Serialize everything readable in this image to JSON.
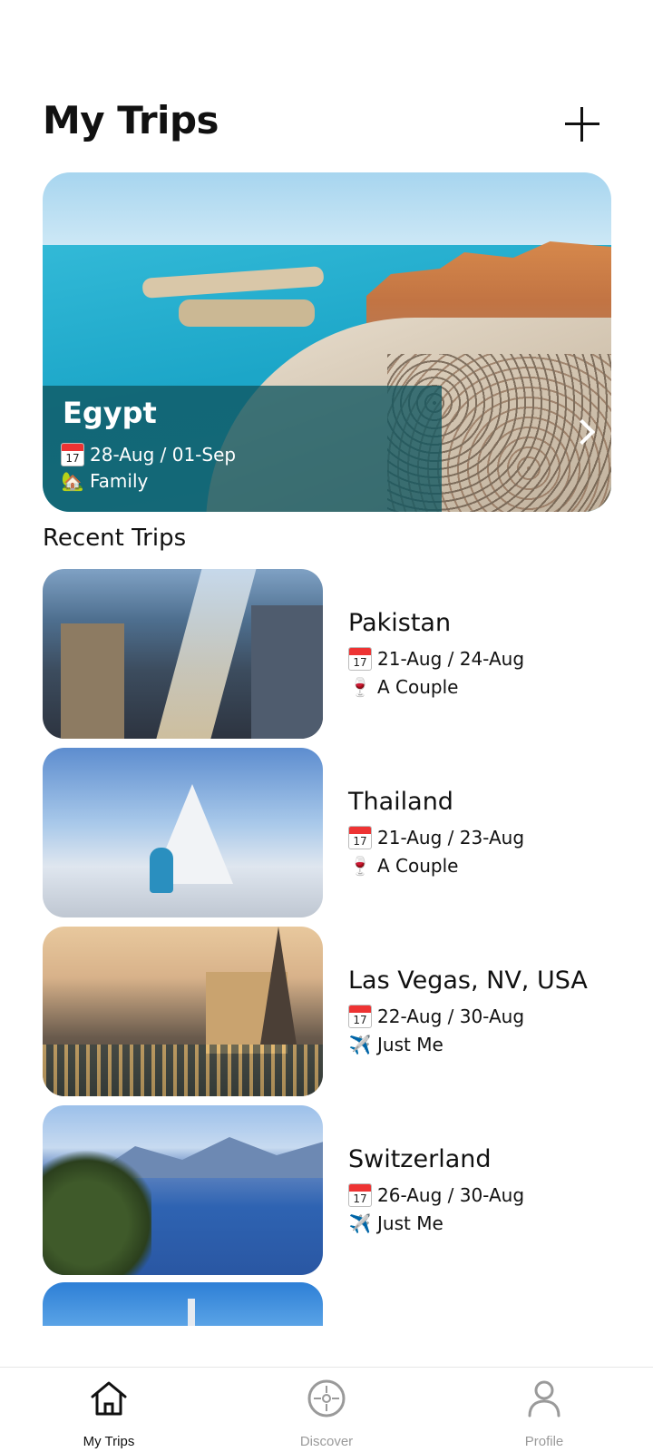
{
  "header": {
    "title": "My Trips",
    "add_icon": "plus-icon"
  },
  "featured_trip": {
    "name": "Egypt",
    "dates": "28-Aug / 01-Sep",
    "group": "Family",
    "date_icon": "calendar-icon",
    "group_icon": "house-icon",
    "chevron_icon": "chevron-right-icon"
  },
  "recent": {
    "title": "Recent Trips",
    "trips": [
      {
        "name": "Pakistan",
        "dates": "21-Aug / 24-Aug",
        "group": "A Couple",
        "group_icon": "wine-glass-icon"
      },
      {
        "name": "Thailand",
        "dates": "21-Aug / 23-Aug",
        "group": "A Couple",
        "group_icon": "wine-glass-icon"
      },
      {
        "name": "Las Vegas, NV, USA",
        "dates": "22-Aug / 30-Aug",
        "group": "Just Me",
        "group_icon": "airplane-icon"
      },
      {
        "name": "Switzerland",
        "dates": "26-Aug / 30-Aug",
        "group": "Just Me",
        "group_icon": "airplane-icon"
      }
    ]
  },
  "calendar_day": "17",
  "tabbar": {
    "tabs": [
      {
        "label": "My Trips",
        "icon": "home-icon",
        "active": true
      },
      {
        "label": "Discover",
        "icon": "compass-icon",
        "active": false
      },
      {
        "label": "Profile",
        "icon": "person-icon",
        "active": false
      }
    ]
  }
}
